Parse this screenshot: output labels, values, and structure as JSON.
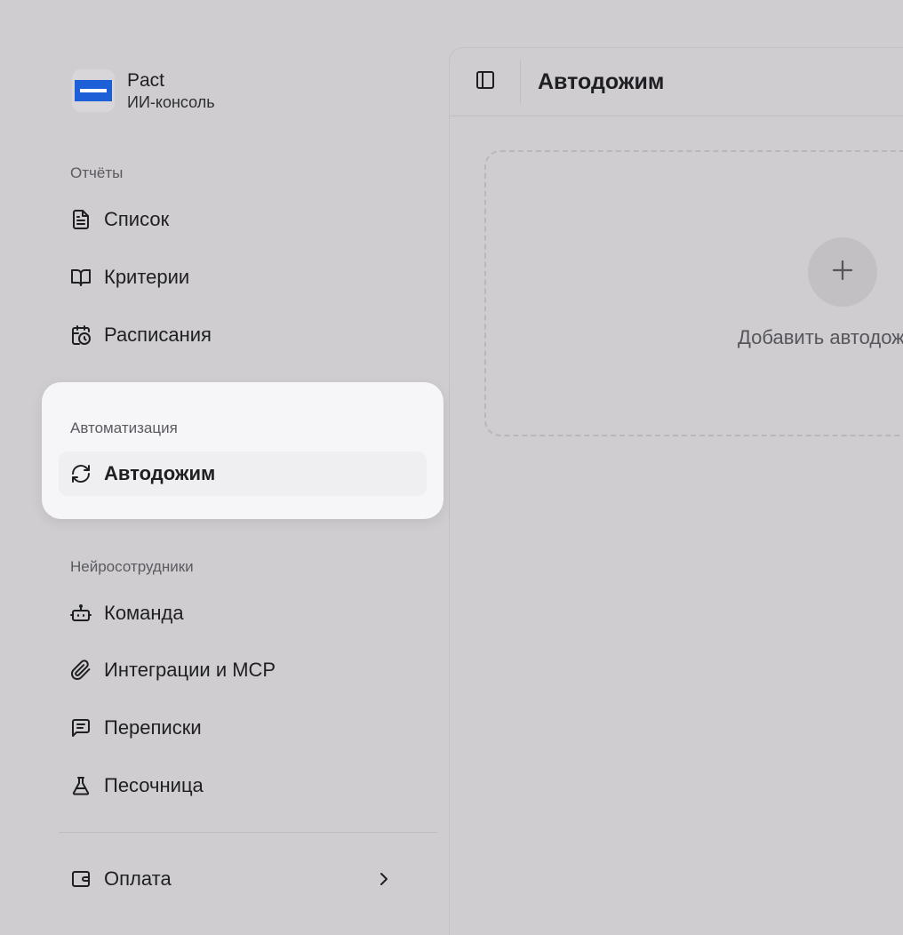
{
  "brand": {
    "name": "Pact",
    "subtitle": "ИИ-консоль"
  },
  "sidebar": {
    "sections": [
      {
        "title": "Отчёты",
        "items": [
          {
            "label": "Список",
            "icon": "document-icon"
          },
          {
            "label": "Критерии",
            "icon": "book-open-icon"
          },
          {
            "label": "Расписания",
            "icon": "calendar-clock-icon"
          }
        ]
      },
      {
        "title": "Автоматизация",
        "items": [
          {
            "label": "Автодожим",
            "icon": "refresh-icon",
            "active": true
          }
        ]
      },
      {
        "title": "Нейросотрудники",
        "items": [
          {
            "label": "Команда",
            "icon": "bot-icon"
          },
          {
            "label": "Интеграции и MCP",
            "icon": "paperclip-icon"
          },
          {
            "label": "Переписки",
            "icon": "message-square-icon"
          },
          {
            "label": "Песочница",
            "icon": "flask-icon"
          }
        ]
      }
    ],
    "footer": {
      "label": "Оплата",
      "icon": "wallet-icon"
    }
  },
  "main": {
    "title": "Автодожим",
    "add_label": "Добавить автодожим"
  },
  "colors": {
    "brand": "#1d5fd6",
    "background": "#cfcdd0",
    "active_card": "#f6f5f8"
  }
}
